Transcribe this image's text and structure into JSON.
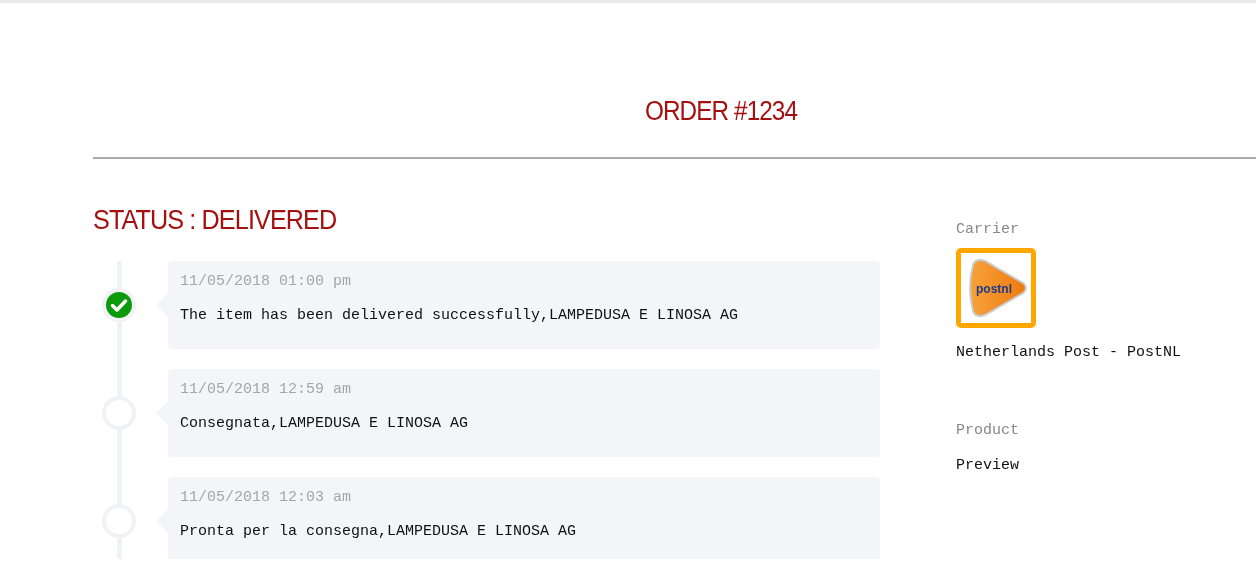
{
  "order_title": "ORDER #1234",
  "status_heading": "STATUS : DELIVERED",
  "events": [
    {
      "time": "11/05/2018 01:00 pm",
      "message": "The item has been delivered successfully,LAMPEDUSA E LINOSA AG",
      "completed": true
    },
    {
      "time": "11/05/2018 12:59 am",
      "message": "Consegnata,LAMPEDUSA E LINOSA AG",
      "completed": false
    },
    {
      "time": "11/05/2018 12:03 am",
      "message": "Pronta per la consegna,LAMPEDUSA E LINOSA AG",
      "completed": false
    }
  ],
  "carrier": {
    "label": "Carrier",
    "logo_text": "postnl",
    "name": "Netherlands Post - PostNL"
  },
  "product": {
    "label": "Product",
    "value": "Preview"
  }
}
